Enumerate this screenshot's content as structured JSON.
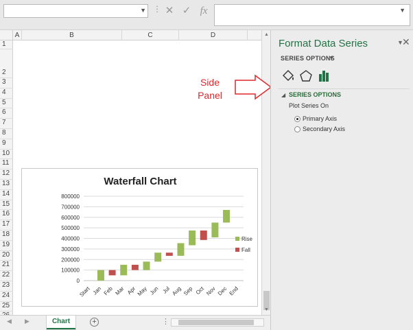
{
  "formula_bar": {
    "name_box_value": "",
    "cancel_icon": "✕",
    "enter_icon": "✓",
    "fx_label": "fx",
    "formula_value": ""
  },
  "columns": [
    "A",
    "B",
    "C",
    "D"
  ],
  "rows": [
    "1",
    "2",
    "3",
    "4",
    "5",
    "6",
    "7",
    "8",
    "9",
    "10",
    "11",
    "12",
    "13",
    "14",
    "15",
    "16",
    "17",
    "18",
    "19",
    "20",
    "21",
    "22",
    "23",
    "24",
    "25",
    "26"
  ],
  "chart": {
    "title": "Waterfall Chart"
  },
  "chart_data": {
    "type": "bar",
    "title": "Waterfall Chart",
    "categories": [
      "Start",
      "Jan",
      "Feb",
      "Mar",
      "Apr",
      "May",
      "Jun",
      "Jul",
      "Aug",
      "Sep",
      "Oct",
      "Nov",
      "Dec",
      "End"
    ],
    "series": [
      {
        "name": "Rise",
        "color": "#9bbb59",
        "ranges": [
          null,
          [
            0,
            100000
          ],
          null,
          [
            50000,
            150000
          ],
          null,
          [
            100000,
            180000
          ],
          [
            180000,
            265000
          ],
          null,
          [
            235000,
            355000
          ],
          [
            335000,
            475000
          ],
          null,
          [
            410000,
            550000
          ],
          [
            550000,
            670000
          ],
          null
        ]
      },
      {
        "name": "Fall",
        "color": "#c0504d",
        "ranges": [
          null,
          null,
          [
            50000,
            100000
          ],
          null,
          [
            100000,
            150000
          ],
          null,
          null,
          [
            235000,
            265000
          ],
          null,
          null,
          [
            385000,
            475000
          ],
          null,
          null,
          null
        ]
      }
    ],
    "ylim": [
      0,
      800000
    ],
    "y_ticks": [
      "0",
      "100000",
      "200000",
      "300000",
      "400000",
      "500000",
      "600000",
      "700000",
      "800000"
    ],
    "grid": true,
    "legend_position": "right"
  },
  "annotation": {
    "line1": "Side",
    "line2": "Panel",
    "color": "#e0262a"
  },
  "sheet_tabs": [
    {
      "label": "Chart",
      "active": true
    }
  ],
  "add_sheet_label": "+",
  "panel": {
    "title": "Format Data Series",
    "series_options_dropdown": "SERIES OPTIONS",
    "section_title": "SERIES OPTIONS",
    "plot_series_on": "Plot Series On",
    "options": [
      {
        "label": "Primary Axis",
        "selected": true
      },
      {
        "label": "Secondary Axis",
        "selected": false
      }
    ],
    "accent_color": "#217346"
  }
}
